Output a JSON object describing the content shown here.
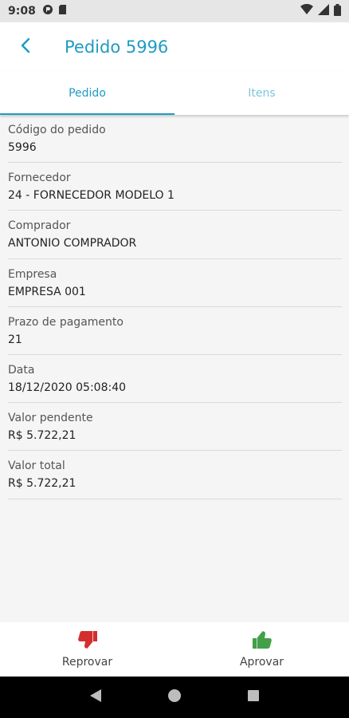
{
  "status_bar": {
    "time": "9:08",
    "icons": [
      "app-notification-icon",
      "sim-card-icon",
      "wifi-icon",
      "signal-icon",
      "battery-icon"
    ]
  },
  "header": {
    "title": "Pedido 5996",
    "back_icon": "chevron-left-icon"
  },
  "tabs": [
    {
      "label": "Pedido",
      "active": true
    },
    {
      "label": "Itens",
      "active": false
    }
  ],
  "fields": [
    {
      "label": "Código do pedido",
      "value": "5996"
    },
    {
      "label": "Fornecedor",
      "value": "24 - FORNECEDOR MODELO 1"
    },
    {
      "label": "Comprador",
      "value": "ANTONIO COMPRADOR"
    },
    {
      "label": "Empresa",
      "value": "EMPRESA 001"
    },
    {
      "label": "Prazo de pagamento",
      "value": "21"
    },
    {
      "label": "Data",
      "value": "18/12/2020 05:08:40"
    },
    {
      "label": "Valor pendente",
      "value": "R$ 5.722,21"
    },
    {
      "label": "Valor total",
      "value": "R$ 5.722,21"
    }
  ],
  "actions": {
    "reject": {
      "label": "Reprovar",
      "icon": "thumbs-down-icon",
      "color": "#d32f2f"
    },
    "approve": {
      "label": "Aprovar",
      "icon": "thumbs-up-icon",
      "color": "#43a047"
    }
  },
  "colors": {
    "accent": "#1f9bc4"
  }
}
